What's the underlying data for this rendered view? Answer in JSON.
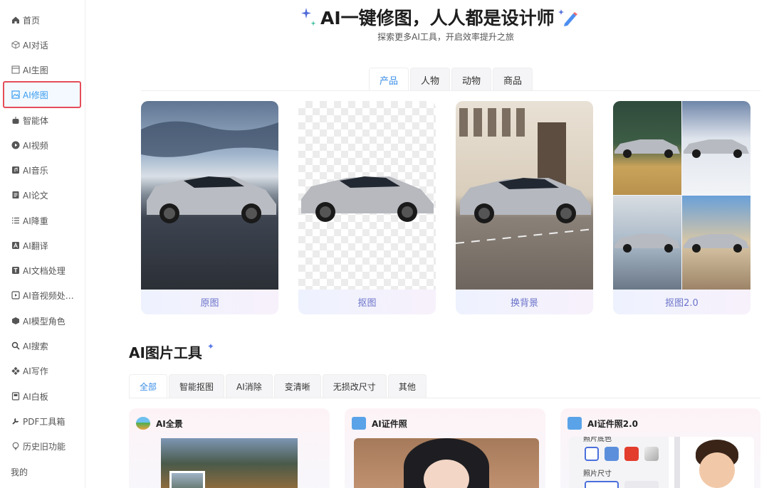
{
  "sidebar": {
    "items": [
      {
        "label": "首页",
        "icon": "home-icon"
      },
      {
        "label": "AI对话",
        "icon": "cube-icon"
      },
      {
        "label": "AI生图",
        "icon": "image-frame-icon"
      },
      {
        "label": "AI修图",
        "icon": "image-edit-icon",
        "active": true
      },
      {
        "label": "智能体",
        "icon": "robot-icon"
      },
      {
        "label": "AI视频",
        "icon": "play-icon"
      },
      {
        "label": "AI音乐",
        "icon": "music-icon"
      },
      {
        "label": "AI论文",
        "icon": "document-icon"
      },
      {
        "label": "AI降重",
        "icon": "list-icon"
      },
      {
        "label": "AI翻译",
        "icon": "translate-icon"
      },
      {
        "label": "AI文档处理",
        "icon": "doc-process-icon"
      },
      {
        "label": "AI音视频处…",
        "icon": "media-icon"
      },
      {
        "label": "AI模型角色",
        "icon": "model-icon"
      },
      {
        "label": "AI搜索",
        "icon": "search-icon"
      },
      {
        "label": "AI写作",
        "icon": "write-icon"
      },
      {
        "label": "AI白板",
        "icon": "whiteboard-icon"
      },
      {
        "label": "PDF工具箱",
        "icon": "wrench-icon"
      },
      {
        "label": "历史旧功能",
        "icon": "bulb-icon"
      },
      {
        "label": "我的",
        "icon": ""
      }
    ]
  },
  "hero": {
    "title": "AI一键修图，人人都是设计师",
    "subtitle": "探索更多AI工具，开启效率提升之旅"
  },
  "category_tabs": [
    {
      "label": "产品",
      "active": true
    },
    {
      "label": "人物"
    },
    {
      "label": "动物"
    },
    {
      "label": "商品"
    }
  ],
  "demo_cards": [
    {
      "caption": "原图"
    },
    {
      "caption": "抠图"
    },
    {
      "caption": "换背景"
    },
    {
      "caption": "抠图2.0"
    }
  ],
  "tools_section": {
    "title": "AI图片工具",
    "tabs": [
      {
        "label": "全部",
        "active": true
      },
      {
        "label": "智能抠图"
      },
      {
        "label": "AI消除"
      },
      {
        "label": "变清晰"
      },
      {
        "label": "无损改尺寸"
      },
      {
        "label": "其他"
      }
    ],
    "cards": [
      {
        "title": "AI全景",
        "icon": "landscape-icon"
      },
      {
        "title": "AI证件照",
        "icon": "id-photo-icon"
      },
      {
        "title": "AI证件照2.0",
        "icon": "id-photo-icon",
        "bg_label": "照片底色",
        "size_label": "照片尺寸"
      }
    ]
  },
  "colors": {
    "accent": "#3a8ee6",
    "active_border": "#e54d5a",
    "caption": "#6b73c9"
  }
}
